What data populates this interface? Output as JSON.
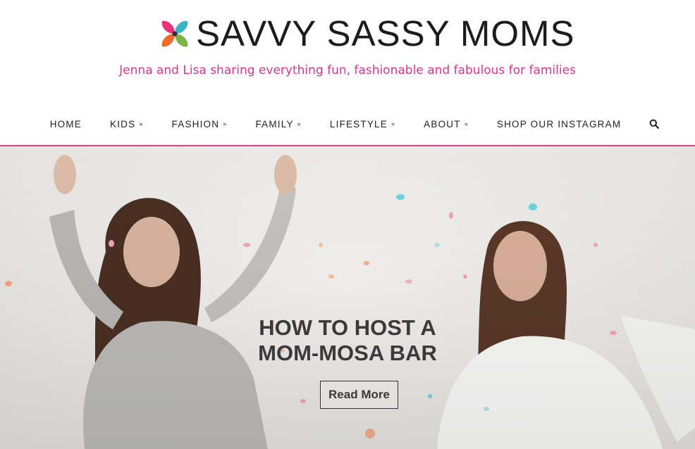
{
  "site": {
    "title": "SAVVY SASSY MOMS",
    "tagline": "Jenna and Lisa sharing everything fun, fashionable and fabulous for families",
    "logo_icon": "four-petal-flower-icon"
  },
  "nav": {
    "items": [
      {
        "label": "HOME",
        "dropdown": false
      },
      {
        "label": "KIDS",
        "dropdown": true
      },
      {
        "label": "FASHION",
        "dropdown": true
      },
      {
        "label": "FAMILY",
        "dropdown": true
      },
      {
        "label": "LIFESTYLE",
        "dropdown": true
      },
      {
        "label": "ABOUT",
        "dropdown": true
      },
      {
        "label": "SHOP OUR INSTAGRAM",
        "dropdown": false
      }
    ],
    "dropdown_icon": "double-chevron-down-icon",
    "search_icon": "search-icon"
  },
  "hero": {
    "title_line1": "HOW TO HOST A",
    "title_line2": "MOM-MOSA BAR",
    "button_label": "Read More"
  },
  "colors": {
    "accent": "#e0338f",
    "nav_border": "#d9417f",
    "logo_petals": [
      "#e8337b",
      "#f06a2b",
      "#3bb3c9",
      "#7cb342"
    ]
  }
}
